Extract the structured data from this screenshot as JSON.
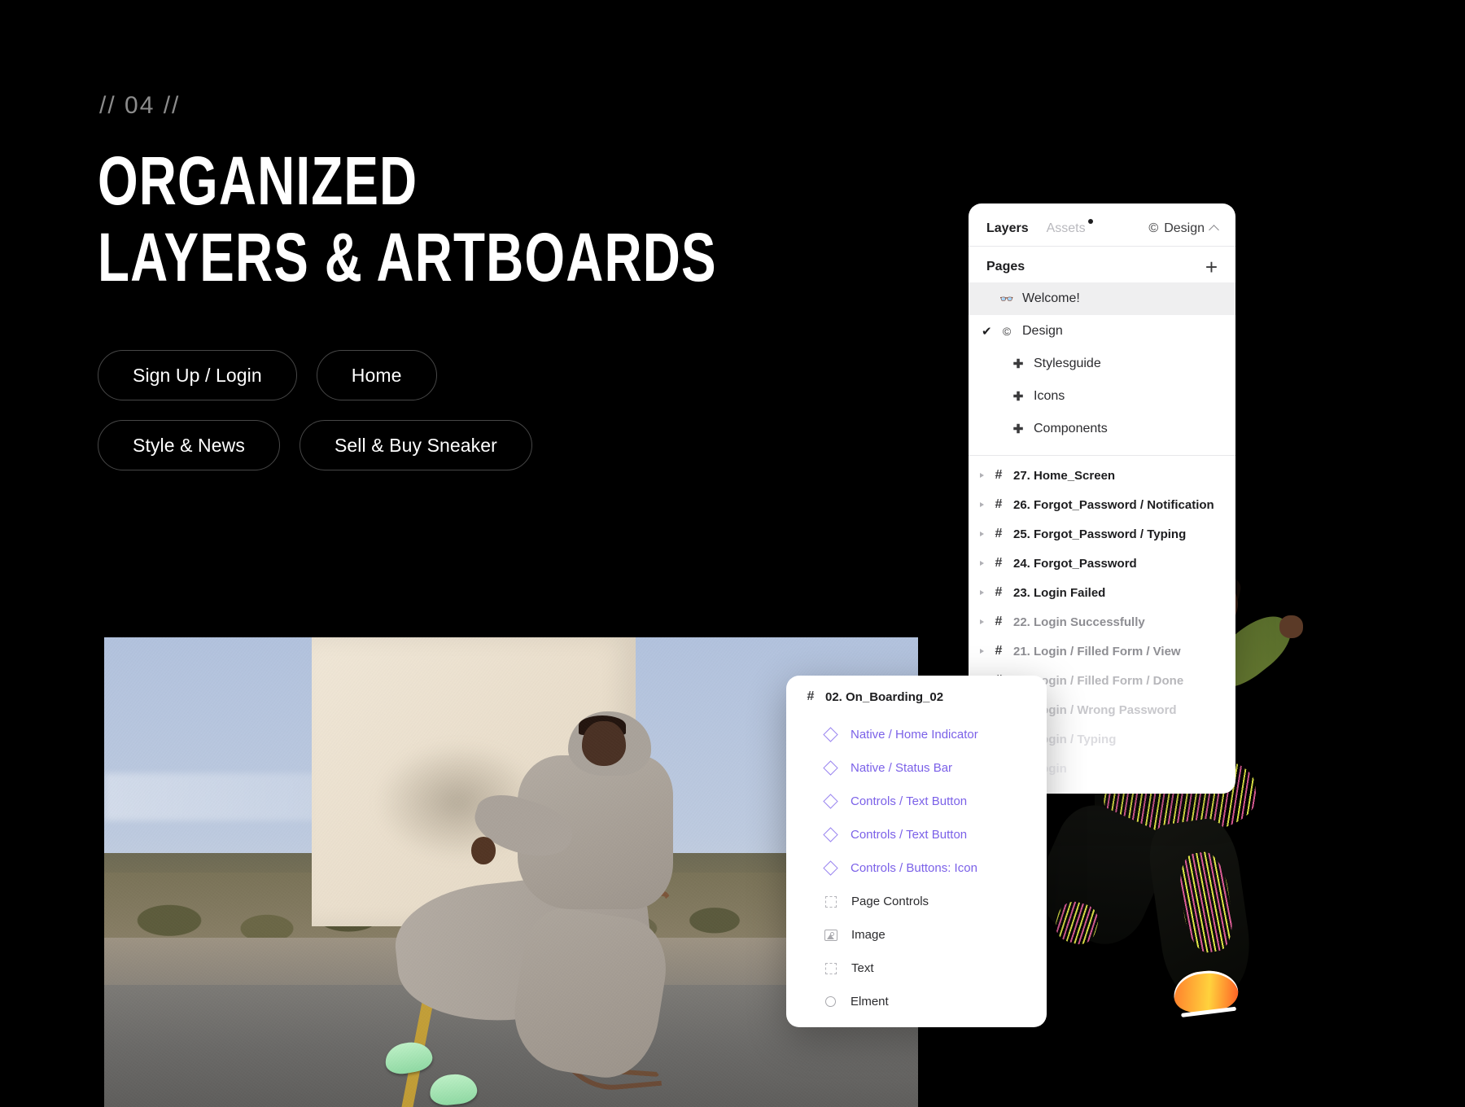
{
  "hero": {
    "kicker": "// 04 //",
    "headline_line1": "ORGANIZED",
    "headline_line2": "LAYERS & ARTBOARDS",
    "buttons": [
      "Sign Up / Login",
      "Home",
      "Style & News",
      "Sell & Buy Sneaker"
    ]
  },
  "layers_panel": {
    "tabs": {
      "layers": "Layers",
      "assets": "Assets"
    },
    "document_select": "Design",
    "document_icon": "©",
    "pages": {
      "title": "Pages",
      "add_label": "+",
      "items": [
        {
          "icon": "👓",
          "label": "Welcome!",
          "selected": true,
          "checked": false,
          "sub": false
        },
        {
          "icon": "©",
          "label": "Design",
          "selected": false,
          "checked": true,
          "sub": false
        },
        {
          "icon": "✚",
          "label": "Stylesguide",
          "selected": false,
          "checked": false,
          "sub": true
        },
        {
          "icon": "✚",
          "label": "Icons",
          "selected": false,
          "checked": false,
          "sub": true
        },
        {
          "icon": "✚",
          "label": "Components",
          "selected": false,
          "checked": false,
          "sub": true
        }
      ]
    },
    "artboards": [
      "27. Home_Screen",
      "26. Forgot_Password / Notification",
      "25. Forgot_Password / Typing",
      "24. Forgot_Password",
      "23. Login Failed",
      "22. Login Successfully",
      "21. Login / Filled Form / View",
      "20. Login / Filled Form / Done",
      "19. Login / Wrong Password",
      "18. Login / Typing",
      "17. Login"
    ]
  },
  "detail_panel": {
    "title": "02. On_Boarding_02",
    "title_icon": "#",
    "layers": [
      {
        "label": "Native / Home Indicator",
        "icon": "diamond",
        "type": "symbol"
      },
      {
        "label": "Native / Status Bar",
        "icon": "diamond",
        "type": "symbol"
      },
      {
        "label": "Controls / Text Button",
        "icon": "diamond",
        "type": "symbol"
      },
      {
        "label": "Controls / Text Button",
        "icon": "diamond",
        "type": "symbol"
      },
      {
        "label": "Controls / Buttons: Icon",
        "icon": "diamond",
        "type": "symbol"
      },
      {
        "label": "Page Controls",
        "icon": "dashed",
        "type": "plain"
      },
      {
        "label": "Image",
        "icon": "image",
        "type": "plain"
      },
      {
        "label": "Text",
        "icon": "dashed",
        "type": "plain"
      },
      {
        "label": "Elment",
        "icon": "circle",
        "type": "plain"
      }
    ]
  },
  "colors": {
    "background": "#000000",
    "panel": "#ffffff",
    "symbol_purple": "#7b61e8",
    "text_primary": "#1d1d1f",
    "text_muted": "#b9b9be",
    "selected_row": "#efeff0"
  }
}
